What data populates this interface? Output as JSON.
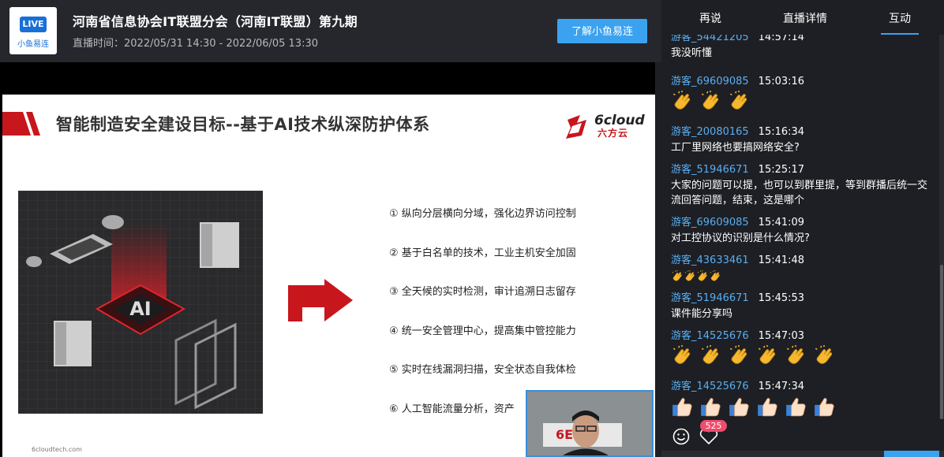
{
  "header": {
    "logo_live": "LIVE",
    "logo_brand": "小鱼易连",
    "title": "河南省信息协会IT联盟分会（河南IT联盟）第九期",
    "time": "直播时间：2022/05/31 14:30 - 2022/06/05 13:30",
    "learn_button": "了解小鱼易连"
  },
  "slide": {
    "title": "智能制造安全建设目标--基于AI技术纵深防护体系",
    "logo_text1": "6cloud",
    "logo_text2": "六方云",
    "center_label": "AI",
    "points": [
      "① 纵向分层横向分域，强化边界访问控制",
      "② 基于白名单的技术，工业主机安全加固",
      "③ 全天候的实时检测，审计追溯日志留存",
      "④ 统一安全管理中心，提高集中管控能力",
      "⑤ 实时在线漏洞扫描，安全状态自我体检",
      "⑥ 人工智能流量分析，资产"
    ],
    "url": "6cloudtech.com",
    "colors": {
      "accent": "#c8161d"
    }
  },
  "sidebar": {
    "tabs": [
      "再说",
      "直播详情",
      "互动"
    ],
    "active_tab": 2,
    "messages": [
      {
        "user": "游客_54421205",
        "time": "14:57:14",
        "text": "我没听懂",
        "emoji": "",
        "count": 0
      },
      {
        "user": "游客_69609085",
        "time": "15:03:16",
        "text": "",
        "emoji": "clap",
        "count": 3
      },
      {
        "user": "游客_20080165",
        "time": "15:16:34",
        "text": "工厂里网络也要搞网络安全?",
        "emoji": "",
        "count": 0
      },
      {
        "user": "游客_51946671",
        "time": "15:25:17",
        "text": "大家的问题可以提，也可以到群里提，等到群播后统一交流回答问题，结束，这是哪个",
        "emoji": "",
        "count": 0
      },
      {
        "user": "游客_69609085",
        "time": "15:41:09",
        "text": "对工控协议的识别是什么情况?",
        "emoji": "",
        "count": 0
      },
      {
        "user": "游客_43633461",
        "time": "15:41:48",
        "text": "",
        "emoji": "clap",
        "count": 4
      },
      {
        "user": "游客_51946671",
        "time": "15:45:53",
        "text": "课件能分享吗",
        "emoji": "",
        "count": 0
      },
      {
        "user": "游客_14525676",
        "time": "15:47:03",
        "text": "",
        "emoji": "clap",
        "count": 6
      },
      {
        "user": "游客_14525676",
        "time": "15:47:34",
        "text": "",
        "emoji": "thumbs-up",
        "count": 6
      }
    ],
    "like_count": "525",
    "colors": {
      "username": "#5aaef0",
      "active": "#3ba2f0",
      "badge": "#f04b6c"
    }
  }
}
